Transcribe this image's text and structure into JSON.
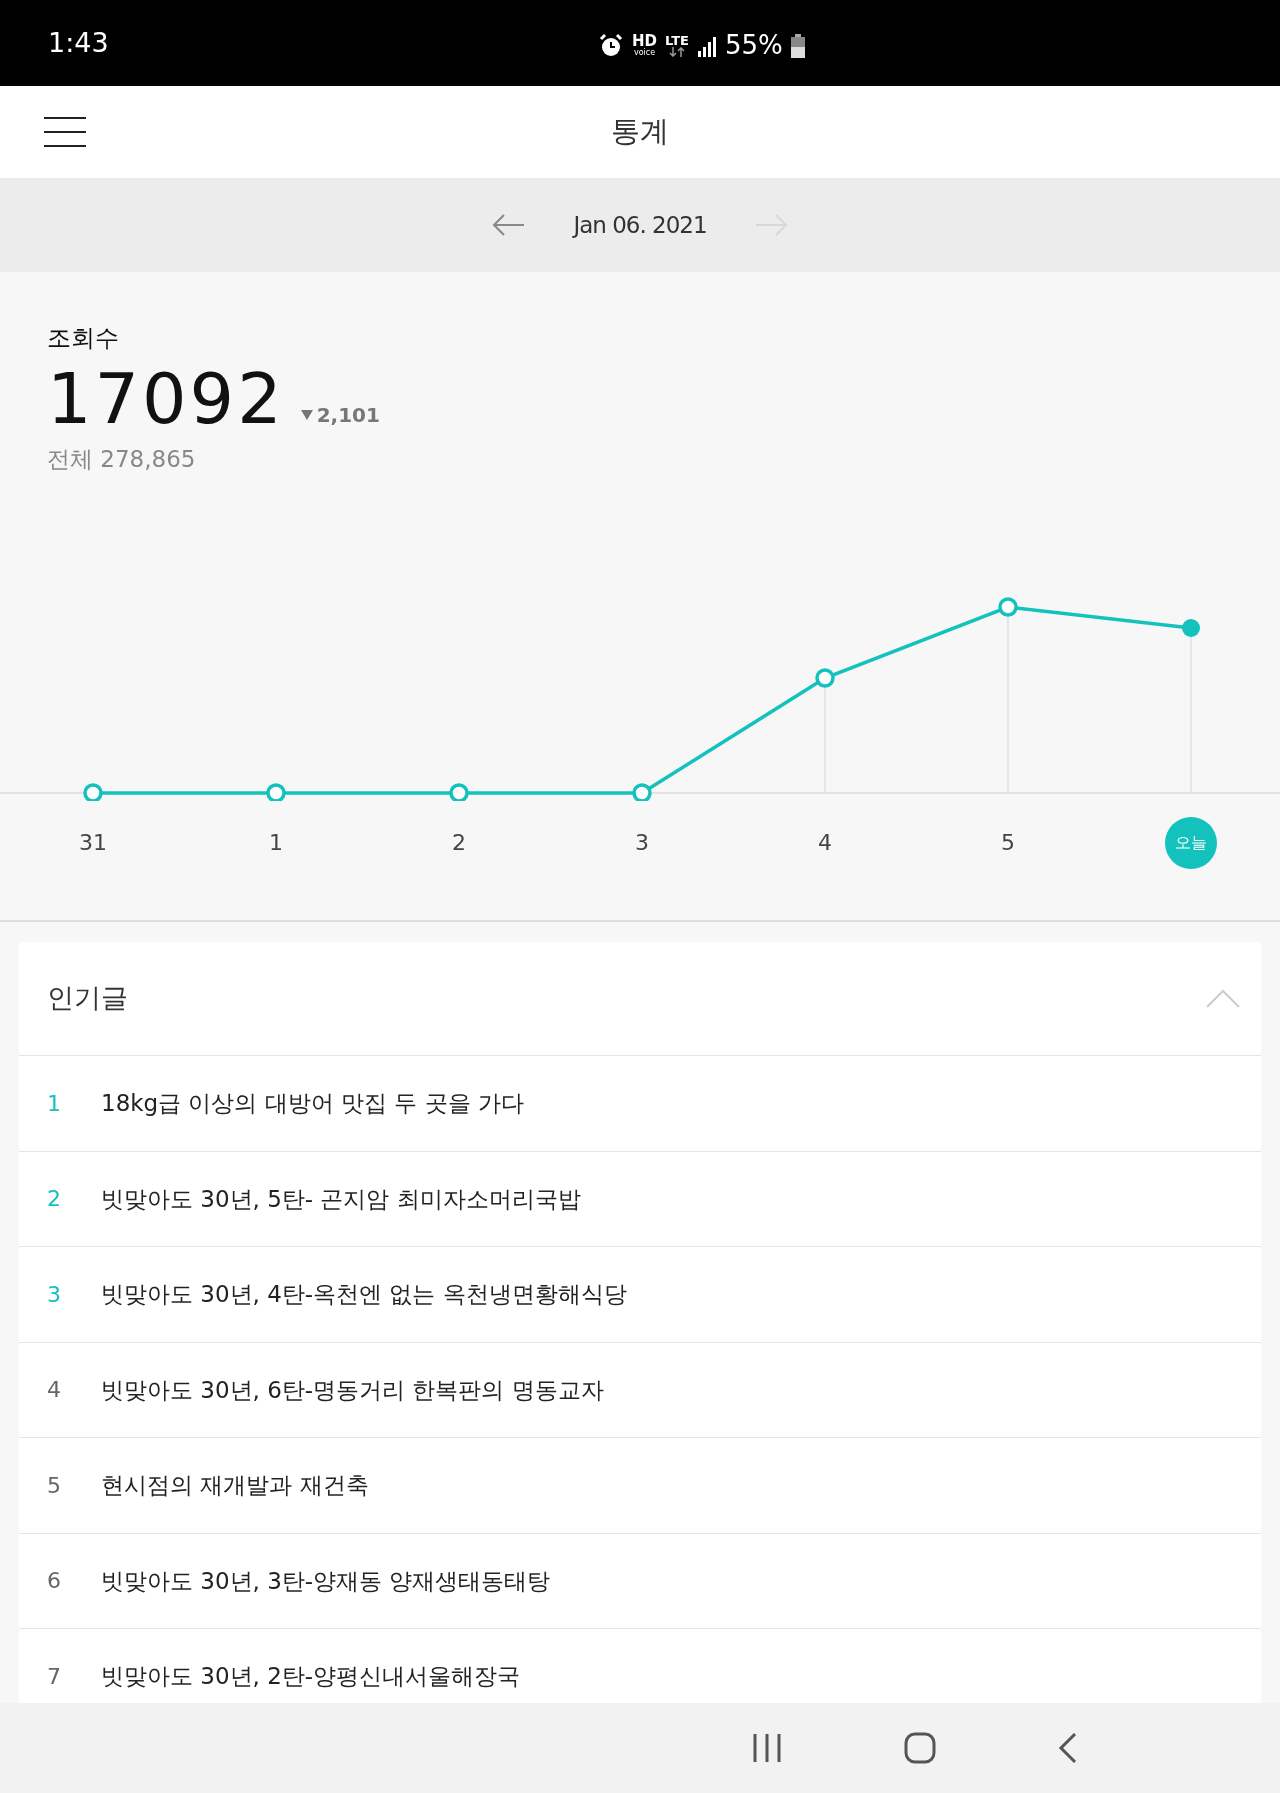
{
  "status_bar": {
    "time": "1:43",
    "hd": "HD",
    "voice": "voice",
    "network": "LTE",
    "battery": "55%"
  },
  "header": {
    "title": "통계"
  },
  "date_nav": {
    "date": "Jan 06. 2021",
    "next_disabled": true
  },
  "stats": {
    "label": "조회수",
    "value": "17092",
    "change": "2,101",
    "total": "전체 278,865"
  },
  "chart": {
    "days": [
      {
        "label": "31",
        "selected": false
      },
      {
        "label": "1",
        "selected": false
      },
      {
        "label": "2",
        "selected": false
      },
      {
        "label": "3",
        "selected": false
      },
      {
        "label": "4",
        "selected": false
      },
      {
        "label": "5",
        "selected": false
      },
      {
        "label": "오늘",
        "selected": true
      }
    ]
  },
  "popular": {
    "title": "인기글",
    "expanded": true,
    "items": [
      {
        "rank": "1",
        "top": true,
        "title": "18kg급 이상의 대방어 맛집 두 곳을 가다"
      },
      {
        "rank": "2",
        "top": true,
        "title": "빗맞아도 30년, 5탄- 곤지암 최미자소머리국밥"
      },
      {
        "rank": "3",
        "top": true,
        "title": "빗맞아도 30년, 4탄-옥천엔 없는 옥천냉면황해식당"
      },
      {
        "rank": "4",
        "top": false,
        "title": "빗맞아도 30년, 6탄-명동거리 한복판의 명동교자"
      },
      {
        "rank": "5",
        "top": false,
        "title": "현시점의 재개발과 재건축"
      },
      {
        "rank": "6",
        "top": false,
        "title": "빗맞아도 30년, 3탄-양재동 양재생태동태탕"
      },
      {
        "rank": "7",
        "top": false,
        "title": "빗맞아도 30년, 2탄-양평신내서울해장국"
      }
    ]
  }
}
